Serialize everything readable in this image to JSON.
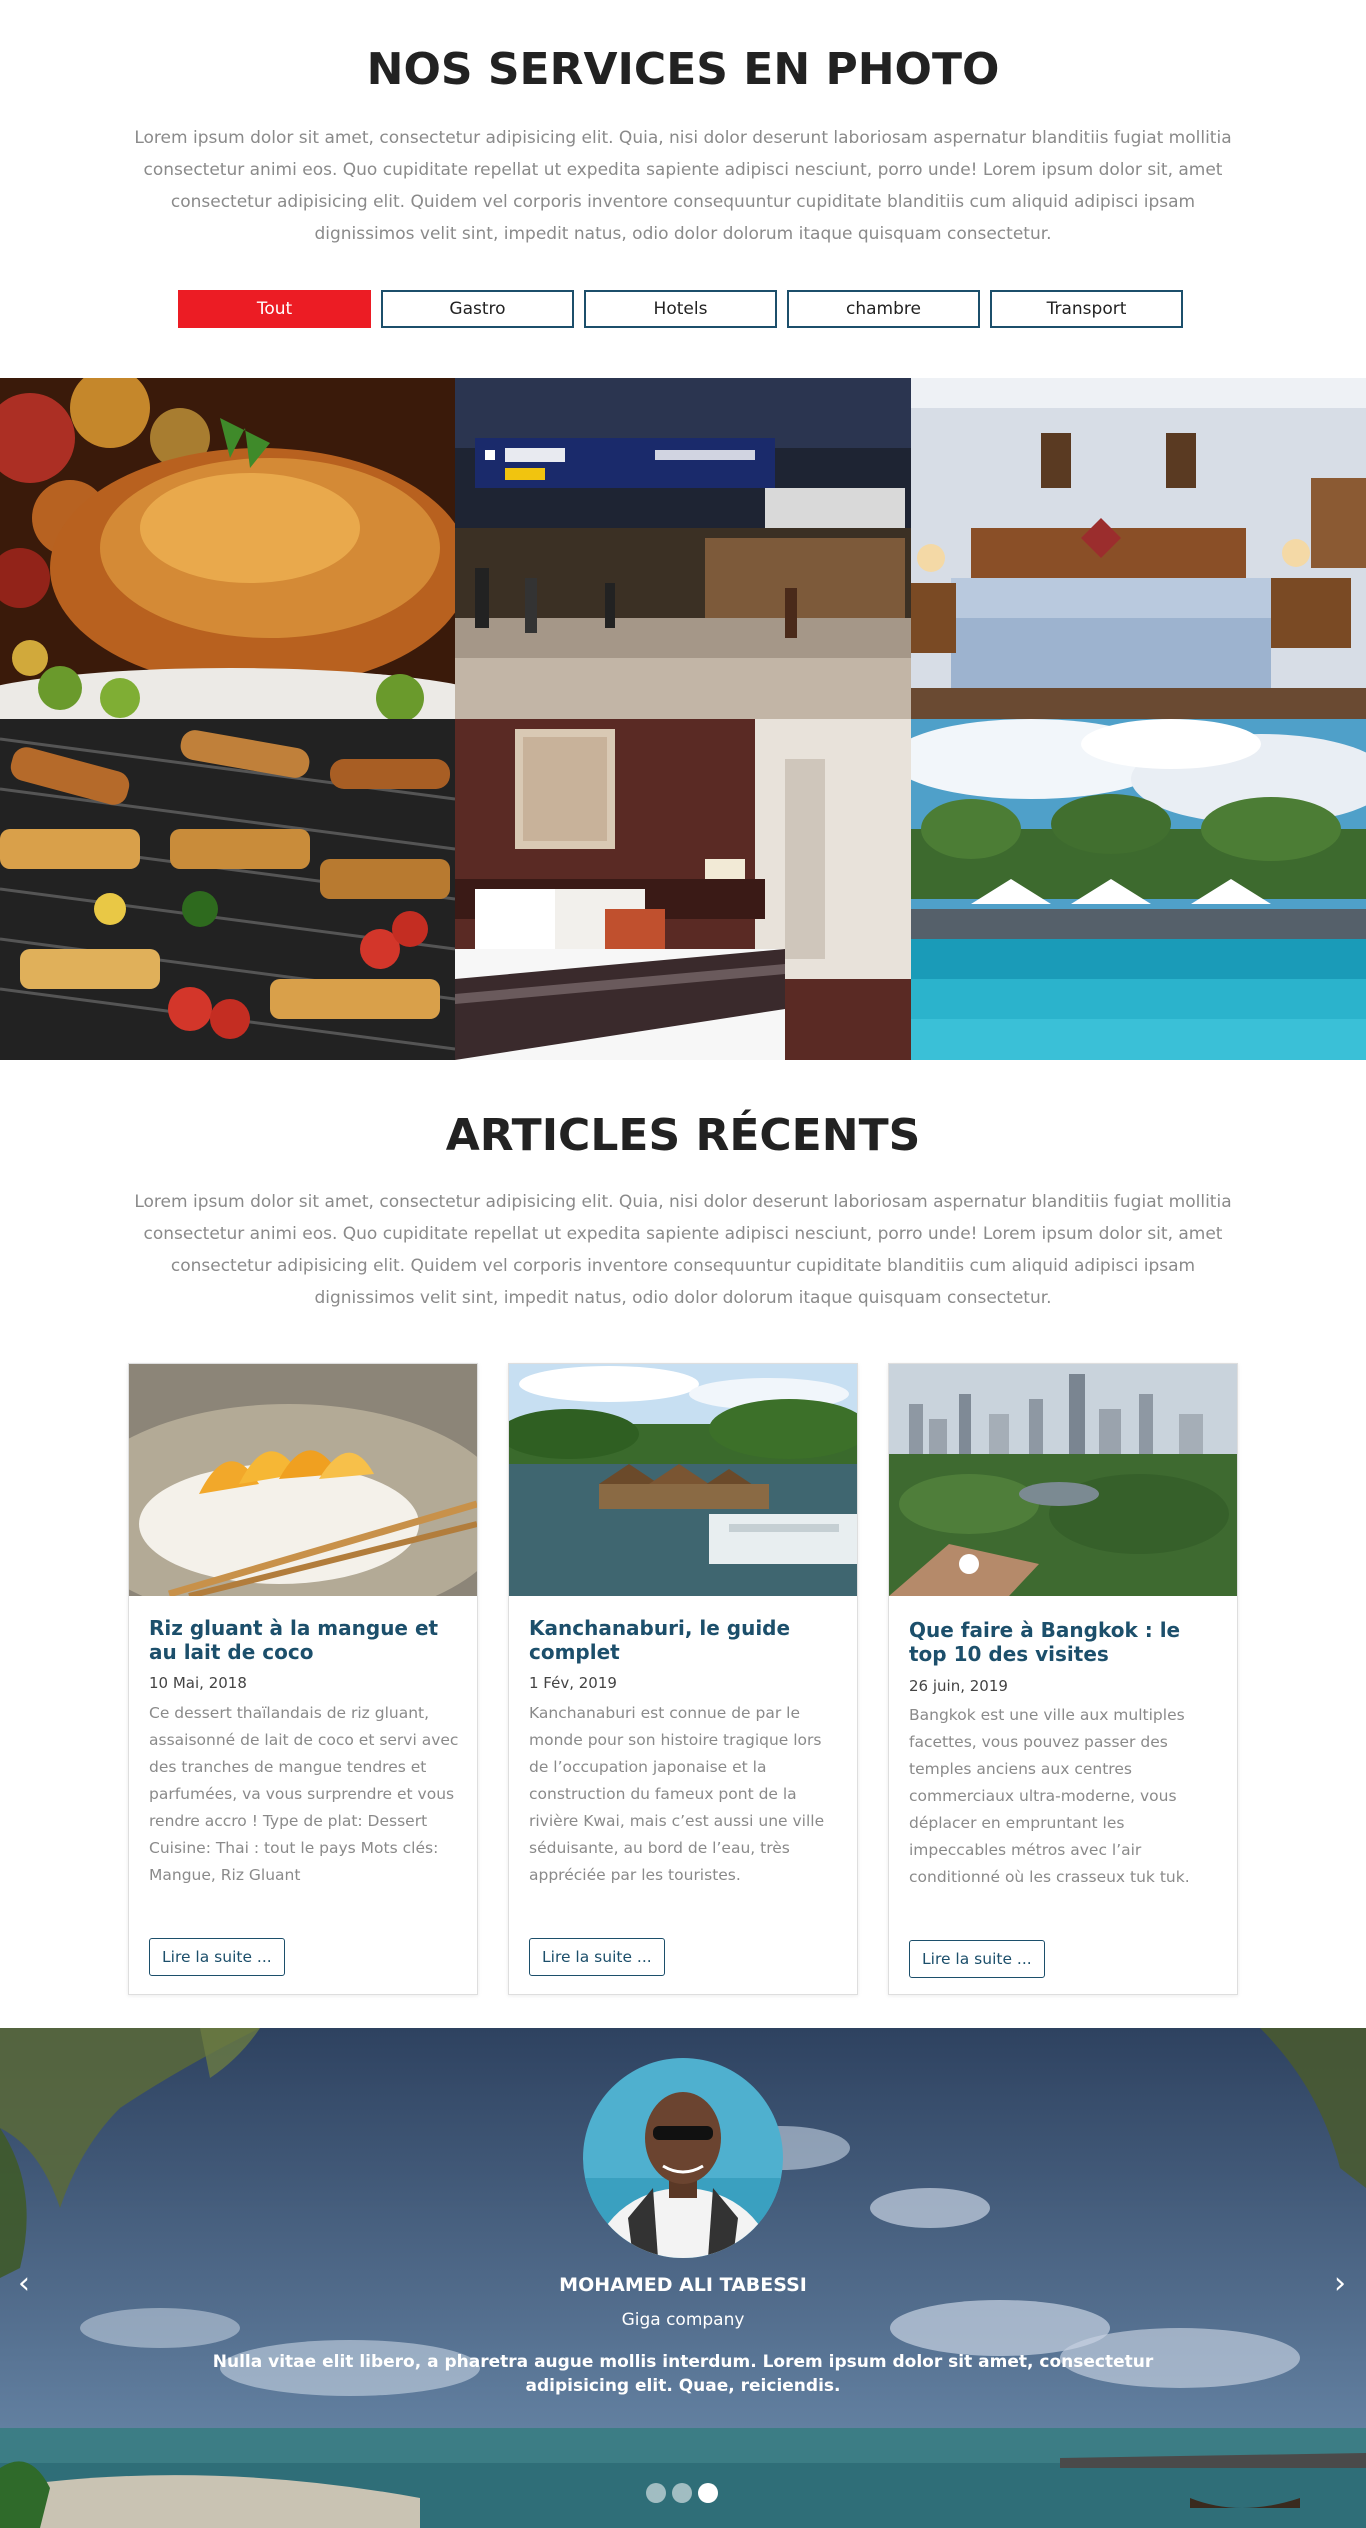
{
  "services": {
    "title": "NOS SERVICES EN PHOTO",
    "lead": "Lorem ipsum dolor sit amet, consectetur adipisicing elit. Quia, nisi dolor deserunt laboriosam aspernatur blanditiis fugiat mollitia consectetur animi eos. Quo cupiditate repellat ut expedita sapiente adipisci nesciunt, porro unde! Lorem ipsum dolor sit, amet consectetur adipisicing elit. Quidem vel corporis inventore consequuntur cupiditate blanditiis cum aliquid adipisci ipsam dignissimos velit sint, impedit natus, odio dolor dolorum itaque quisquam consectetur.",
    "filters": [
      "Tout",
      "Gastro",
      "Hotels",
      "chambre",
      "Transport"
    ],
    "active_filter": "Tout",
    "gallery": [
      "roast-chicken-photo",
      "airport-photo",
      "hotel-bedroom-photo",
      "barbecue-grill-photo",
      "hotel-bed-photo",
      "pool-photo"
    ]
  },
  "articles": {
    "title": "ARTICLES RÉCENTS",
    "lead": "Lorem ipsum dolor sit amet, consectetur adipisicing elit. Quia, nisi dolor deserunt laboriosam aspernatur blanditiis fugiat mollitia consectetur animi eos. Quo cupiditate repellat ut expedita sapiente adipisci nesciunt, porro unde! Lorem ipsum dolor sit, amet consectetur adipisicing elit. Quidem vel corporis inventore consequuntur cupiditate blanditiis cum aliquid adipisci ipsam dignissimos velit sint, impedit natus, odio dolor dolorum itaque quisquam consectetur.",
    "items": [
      {
        "title": "Riz gluant à la mangue et au lait de coco",
        "date": "10 Mai, 2018",
        "text": "Ce dessert thaïlandais de riz gluant, assaisonné de lait de coco et servi avec des tranches de mangue tendres et parfumées, va vous surprendre et vous rendre accro ! Type de plat: Dessert Cuisine: Thai : tout le pays Mots clés: Mangue, Riz Gluant",
        "button": "Lire la suite ..."
      },
      {
        "title": "Kanchanaburi, le guide complet",
        "date": "1 Fév, 2019",
        "text": "Kanchanaburi est connue de par le monde pour son histoire tragique lors de l’occupation japonaise et la construction du fameux pont de la rivière Kwai, mais c’est aussi une ville séduisante, au bord de l’eau, très appréciée par les touristes.",
        "button": "Lire la suite ..."
      },
      {
        "title": "Que faire à Bangkok : le top 10 des visites",
        "date": "26 juin, 2019",
        "text": "Bangkok est une ville aux multiples facettes, vous pouvez passer des temples anciens aux centres commerciaux ultra-moderne, vous déplacer en empruntant les impeccables métros avec l’air conditionné où les crasseux tuk tuk.",
        "button": "Lire la suite ..."
      }
    ]
  },
  "testimonial": {
    "name": "MOHAMED ALI TABESSI",
    "company": "Giga company",
    "quote": "Nulla vitae elit libero, a pharetra augue mollis interdum. Lorem ipsum dolor sit amet, consectetur adipisicing elit. Quae, reiciendis.",
    "prev_icon": "‹",
    "next_icon": "›",
    "slides": 3,
    "active_slide": 3
  },
  "colors": {
    "accent": "#ec1c24",
    "brand": "#1c4f6b",
    "muted_text": "#8a8a8a"
  }
}
